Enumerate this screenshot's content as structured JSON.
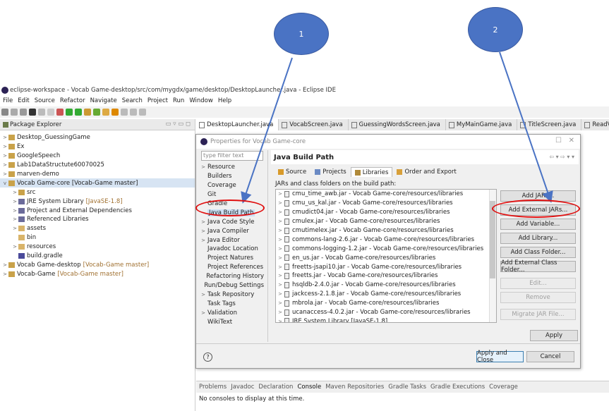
{
  "window": {
    "title": "eclipse-workspace - Vocab Game-desktop/src/com/mygdx/game/desktop/DesktopLauncher.java - Eclipse IDE"
  },
  "menu": [
    "File",
    "Edit",
    "Source",
    "Refactor",
    "Navigate",
    "Search",
    "Project",
    "Run",
    "Window",
    "Help"
  ],
  "package_explorer": {
    "title": "Package Explorer",
    "items": [
      {
        "label": "Desktop_GuessingGame",
        "extra": "",
        "twisty": ">",
        "indent": 0
      },
      {
        "label": "Ex",
        "extra": "",
        "twisty": ">",
        "indent": 0
      },
      {
        "label": "GoogleSpeech",
        "extra": "",
        "twisty": ">",
        "indent": 0
      },
      {
        "label": "Lab1DataStructute60070025",
        "extra": "",
        "twisty": ">",
        "indent": 0
      },
      {
        "label": "marven-demo",
        "extra": "",
        "twisty": ">",
        "indent": 0
      },
      {
        "label": "Vocab Game-core [Vocab-Game master]",
        "extra": "",
        "twisty": "v",
        "indent": 0
      },
      {
        "label": "src",
        "extra": "",
        "twisty": ">",
        "indent": 1
      },
      {
        "label": "JRE System Library",
        "extra": "[JavaSE-1.8]",
        "twisty": ">",
        "indent": 1
      },
      {
        "label": "Project and External Dependencies",
        "extra": "",
        "twisty": ">",
        "indent": 1
      },
      {
        "label": "Referenced Libraries",
        "extra": "",
        "twisty": ">",
        "indent": 1
      },
      {
        "label": "assets",
        "extra": "",
        "twisty": ">",
        "indent": 1
      },
      {
        "label": "bin",
        "extra": "",
        "twisty": "",
        "indent": 1
      },
      {
        "label": "resources",
        "extra": "",
        "twisty": ">",
        "indent": 1
      },
      {
        "label": "build.gradle",
        "extra": "",
        "twisty": "",
        "indent": 1
      },
      {
        "label": "Vocab Game-desktop",
        "extra": "[Vocab-Game master]",
        "twisty": ">",
        "indent": 0
      },
      {
        "label": "Vocab-Game",
        "extra": "[Vocab-Game master]",
        "twisty": ">",
        "indent": 0
      }
    ]
  },
  "editor_tabs": [
    "DesktopLauncher.java",
    "VocabScreen.java",
    "GuessingWordsScreen.java",
    "MyMainGame.java",
    "TitleScreen.java",
    "ReadVocabs.j"
  ],
  "console": {
    "tabs": [
      "Problems",
      "Javadoc",
      "Declaration",
      "Console",
      "Maven Repositories",
      "Gradle Tasks",
      "Gradle Executions",
      "Coverage"
    ],
    "active": "Console",
    "message": "No consoles to display at this time."
  },
  "dialog": {
    "title": "Properties for Vocab Game-core",
    "filter_placeholder": "type filter text",
    "heading": "Java Build Path",
    "categories": [
      {
        "label": "Resource",
        "twisty": ">"
      },
      {
        "label": "Builders",
        "twisty": ""
      },
      {
        "label": "Coverage",
        "twisty": ""
      },
      {
        "label": "Git",
        "twisty": ""
      },
      {
        "label": "Gradle",
        "twisty": ""
      },
      {
        "label": "Java Build Path",
        "twisty": "",
        "selected": true
      },
      {
        "label": "Java Code Style",
        "twisty": ">"
      },
      {
        "label": "Java Compiler",
        "twisty": ">"
      },
      {
        "label": "Java Editor",
        "twisty": ">"
      },
      {
        "label": "Javadoc Location",
        "twisty": ""
      },
      {
        "label": "Project Natures",
        "twisty": ""
      },
      {
        "label": "Project References",
        "twisty": ""
      },
      {
        "label": "Refactoring History",
        "twisty": ""
      },
      {
        "label": "Run/Debug Settings",
        "twisty": ""
      },
      {
        "label": "Task Repository",
        "twisty": ">"
      },
      {
        "label": "Task Tags",
        "twisty": ""
      },
      {
        "label": "Validation",
        "twisty": ">"
      },
      {
        "label": "WikiText",
        "twisty": ""
      }
    ],
    "tabs": [
      "Source",
      "Projects",
      "Libraries",
      "Order and Export"
    ],
    "active_tab": "Libraries",
    "list_header": "JARs and class folders on the build path:",
    "jars": [
      "cmu_time_awb.jar - Vocab Game-core/resources/libraries",
      "cmu_us_kal.jar - Vocab Game-core/resources/libraries",
      "cmudict04.jar - Vocab Game-core/resources/libraries",
      "cmulex.jar - Vocab Game-core/resources/libraries",
      "cmutimelex.jar - Vocab Game-core/resources/libraries",
      "commons-lang-2.6.jar - Vocab Game-core/resources/libraries",
      "commons-logging-1.2.jar - Vocab Game-core/resources/libraries",
      "en_us.jar - Vocab Game-core/resources/libraries",
      "freetts-jsapi10.jar - Vocab Game-core/resources/libraries",
      "freetts.jar - Vocab Game-core/resources/libraries",
      "hsqldb-2.4.0.jar - Vocab Game-core/resources/libraries",
      "jackcess-2.1.8.jar - Vocab Game-core/resources/libraries",
      "mbrola.jar - Vocab Game-core/resources/libraries",
      "ucanaccess-4.0.2.jar - Vocab Game-core/resources/libraries",
      "JRE System Library [JavaSE-1.8]"
    ],
    "buttons": {
      "add_jars": "Add JARs...",
      "add_external_jars": "Add External JARs...",
      "add_variable": "Add Variable...",
      "add_library": "Add Library...",
      "add_class_folder": "Add Class Folder...",
      "add_external_class_folder": "Add External Class Folder...",
      "edit": "Edit...",
      "remove": "Remove",
      "migrate": "Migrate JAR File...",
      "apply": "Apply",
      "apply_close": "Apply and Close",
      "cancel": "Cancel"
    }
  },
  "annotations": {
    "marker1": "1",
    "marker2": "2",
    "marker_color": "#4a73c4",
    "highlight_color": "#e01010"
  }
}
